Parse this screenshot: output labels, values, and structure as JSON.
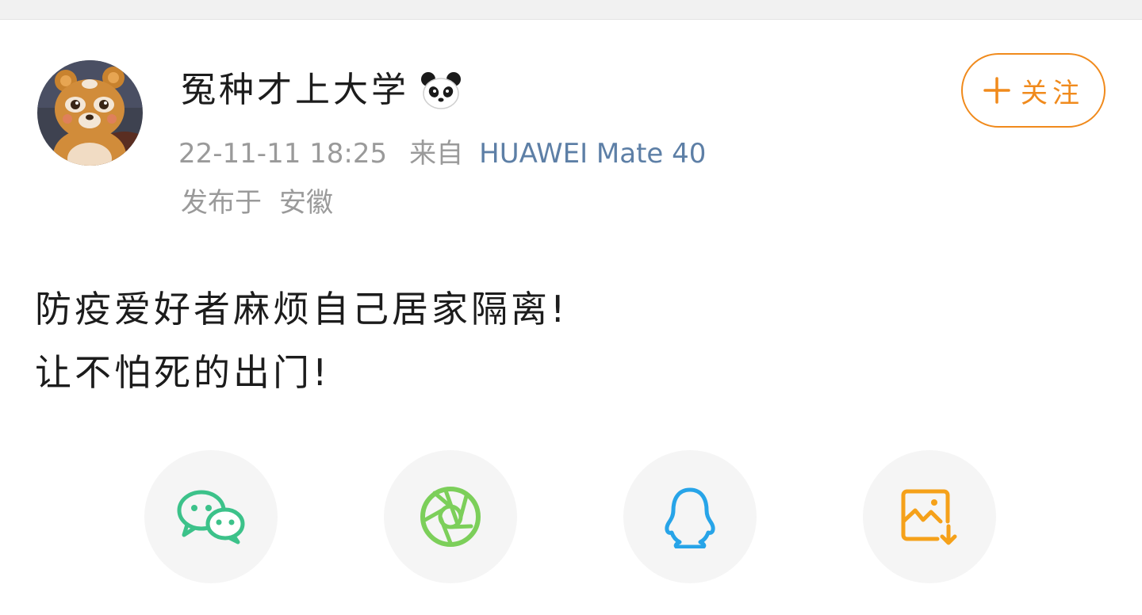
{
  "post": {
    "author": "冤种才上大学",
    "author_badge_icon": "panda-emoji",
    "timestamp": "22-11-11 18:25",
    "source_prefix": "来自",
    "device": "HUAWEI Mate 40",
    "location_prefix": "发布于",
    "location": "安徽",
    "follow_label": "关注",
    "text_lines": [
      "防疫爱好者麻烦自己居家隔离!",
      "让不怕死的出门!"
    ]
  },
  "share": {
    "items": [
      {
        "icon": "wechat-icon",
        "color": "#3cc28a"
      },
      {
        "icon": "moments-icon",
        "color": "#7ccf5a"
      },
      {
        "icon": "qq-icon",
        "color": "#27a4e8"
      },
      {
        "icon": "save-image-icon",
        "color": "#f5a11a"
      }
    ]
  },
  "colors": {
    "accent": "#f08a1c",
    "device_link": "#5d7fa6",
    "meta_text": "#9a9a9a"
  }
}
